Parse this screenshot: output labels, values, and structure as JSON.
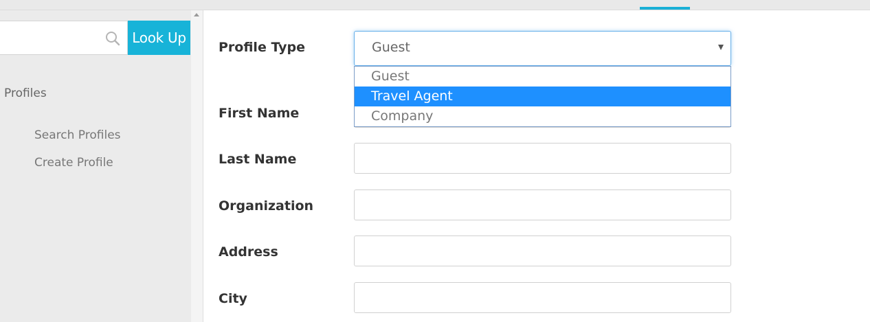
{
  "sidebar": {
    "search": {
      "placeholder": "",
      "button_label": "Look Up"
    },
    "section_title": "Profiles",
    "items": [
      {
        "label": "Search Profiles"
      },
      {
        "label": "Create Profile"
      }
    ]
  },
  "form": {
    "profile_type": {
      "label": "Profile Type",
      "value": "Guest",
      "options": [
        "Guest",
        "Travel Agent",
        "Company"
      ],
      "highlighted": "Travel Agent"
    },
    "first_name": {
      "label": "First Name",
      "value": ""
    },
    "last_name": {
      "label": "Last Name",
      "value": ""
    },
    "organization": {
      "label": "Organization",
      "value": ""
    },
    "address": {
      "label": "Address",
      "value": ""
    },
    "city": {
      "label": "City",
      "value": ""
    }
  },
  "colors": {
    "accent": "#17b3d8",
    "highlight": "#1e90ff",
    "sidebar_bg": "#ebebeb"
  },
  "icons": [
    "search-icon",
    "chevron-down-icon",
    "scroll-up-icon"
  ]
}
